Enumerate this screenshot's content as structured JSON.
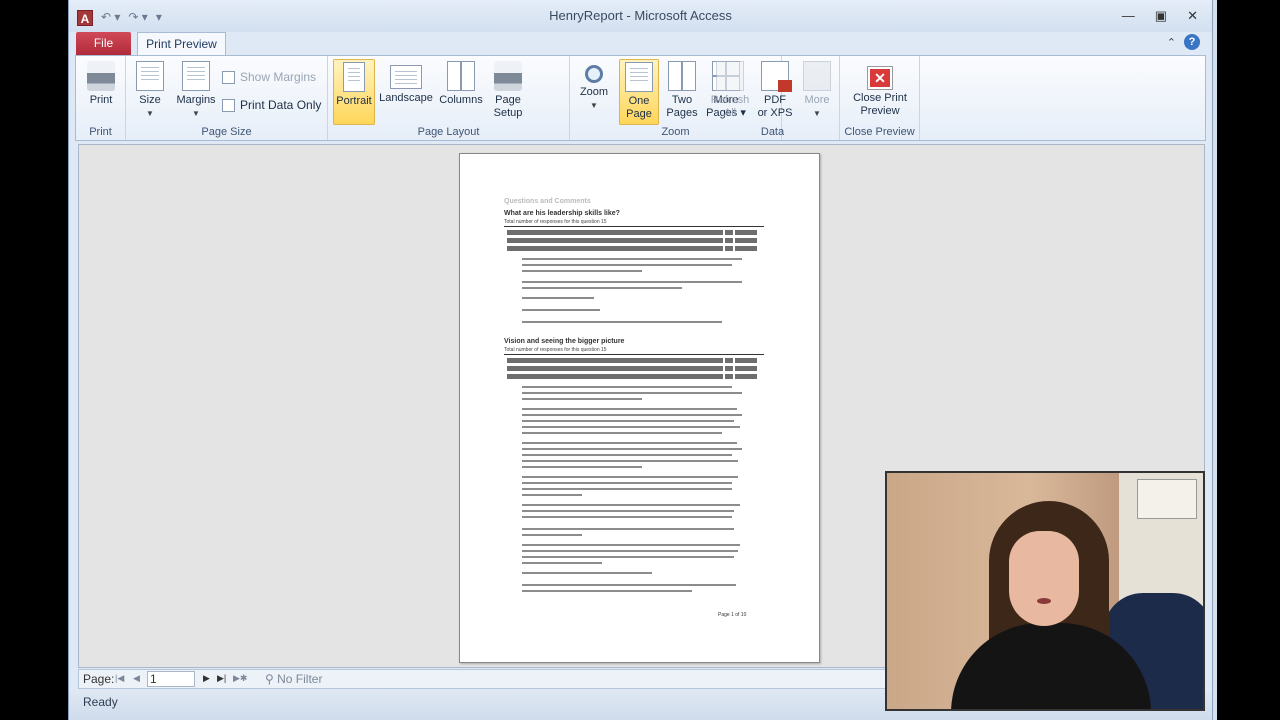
{
  "window": {
    "title": "HenryReport",
    "app": "Microsoft Access",
    "title_full": "HenryReport - Microsoft Access",
    "app_icon": "A"
  },
  "tabs": {
    "file": "File",
    "print_preview": "Print Preview"
  },
  "ribbon": {
    "groups": {
      "print": "Print",
      "page_size": "Page Size",
      "page_layout": "Page Layout",
      "zoom": "Zoom",
      "data": "Data",
      "close_preview": "Close Preview"
    },
    "print": "Print",
    "size": "Size",
    "margins": "Margins",
    "show_margins": "Show Margins",
    "print_data_only": "Print Data Only",
    "portrait": "Portrait",
    "landscape": "Landscape",
    "columns": "Columns",
    "page_setup_1": "Page",
    "page_setup_2": "Setup",
    "zoom": "Zoom",
    "one_page_1": "One",
    "one_page_2": "Page",
    "two_pages_1": "Two",
    "two_pages_2": "Pages",
    "more_pages_1": "More",
    "more_pages_2": "Pages",
    "refresh_1": "Refresh",
    "refresh_2": "All",
    "pdf_1": "PDF",
    "pdf_2": "or XPS",
    "more": "More",
    "close_1": "Close Print",
    "close_2": "Preview"
  },
  "report": {
    "section_title": "Questions and Comments",
    "q1": "What are his leadership skills like?",
    "q1_total": "Total number of responses for this question   15",
    "q2": "Vision and seeing the bigger picture",
    "q2_total": "Total number of responses for this question   15",
    "footer": "Page 1 of 10"
  },
  "nav": {
    "page_label": "Page:",
    "page_value": "1",
    "filter": "No Filter"
  },
  "status": {
    "text": "Ready"
  },
  "colors": {
    "file_tab": "#b02a3b",
    "active_button": "#ffd65a"
  }
}
